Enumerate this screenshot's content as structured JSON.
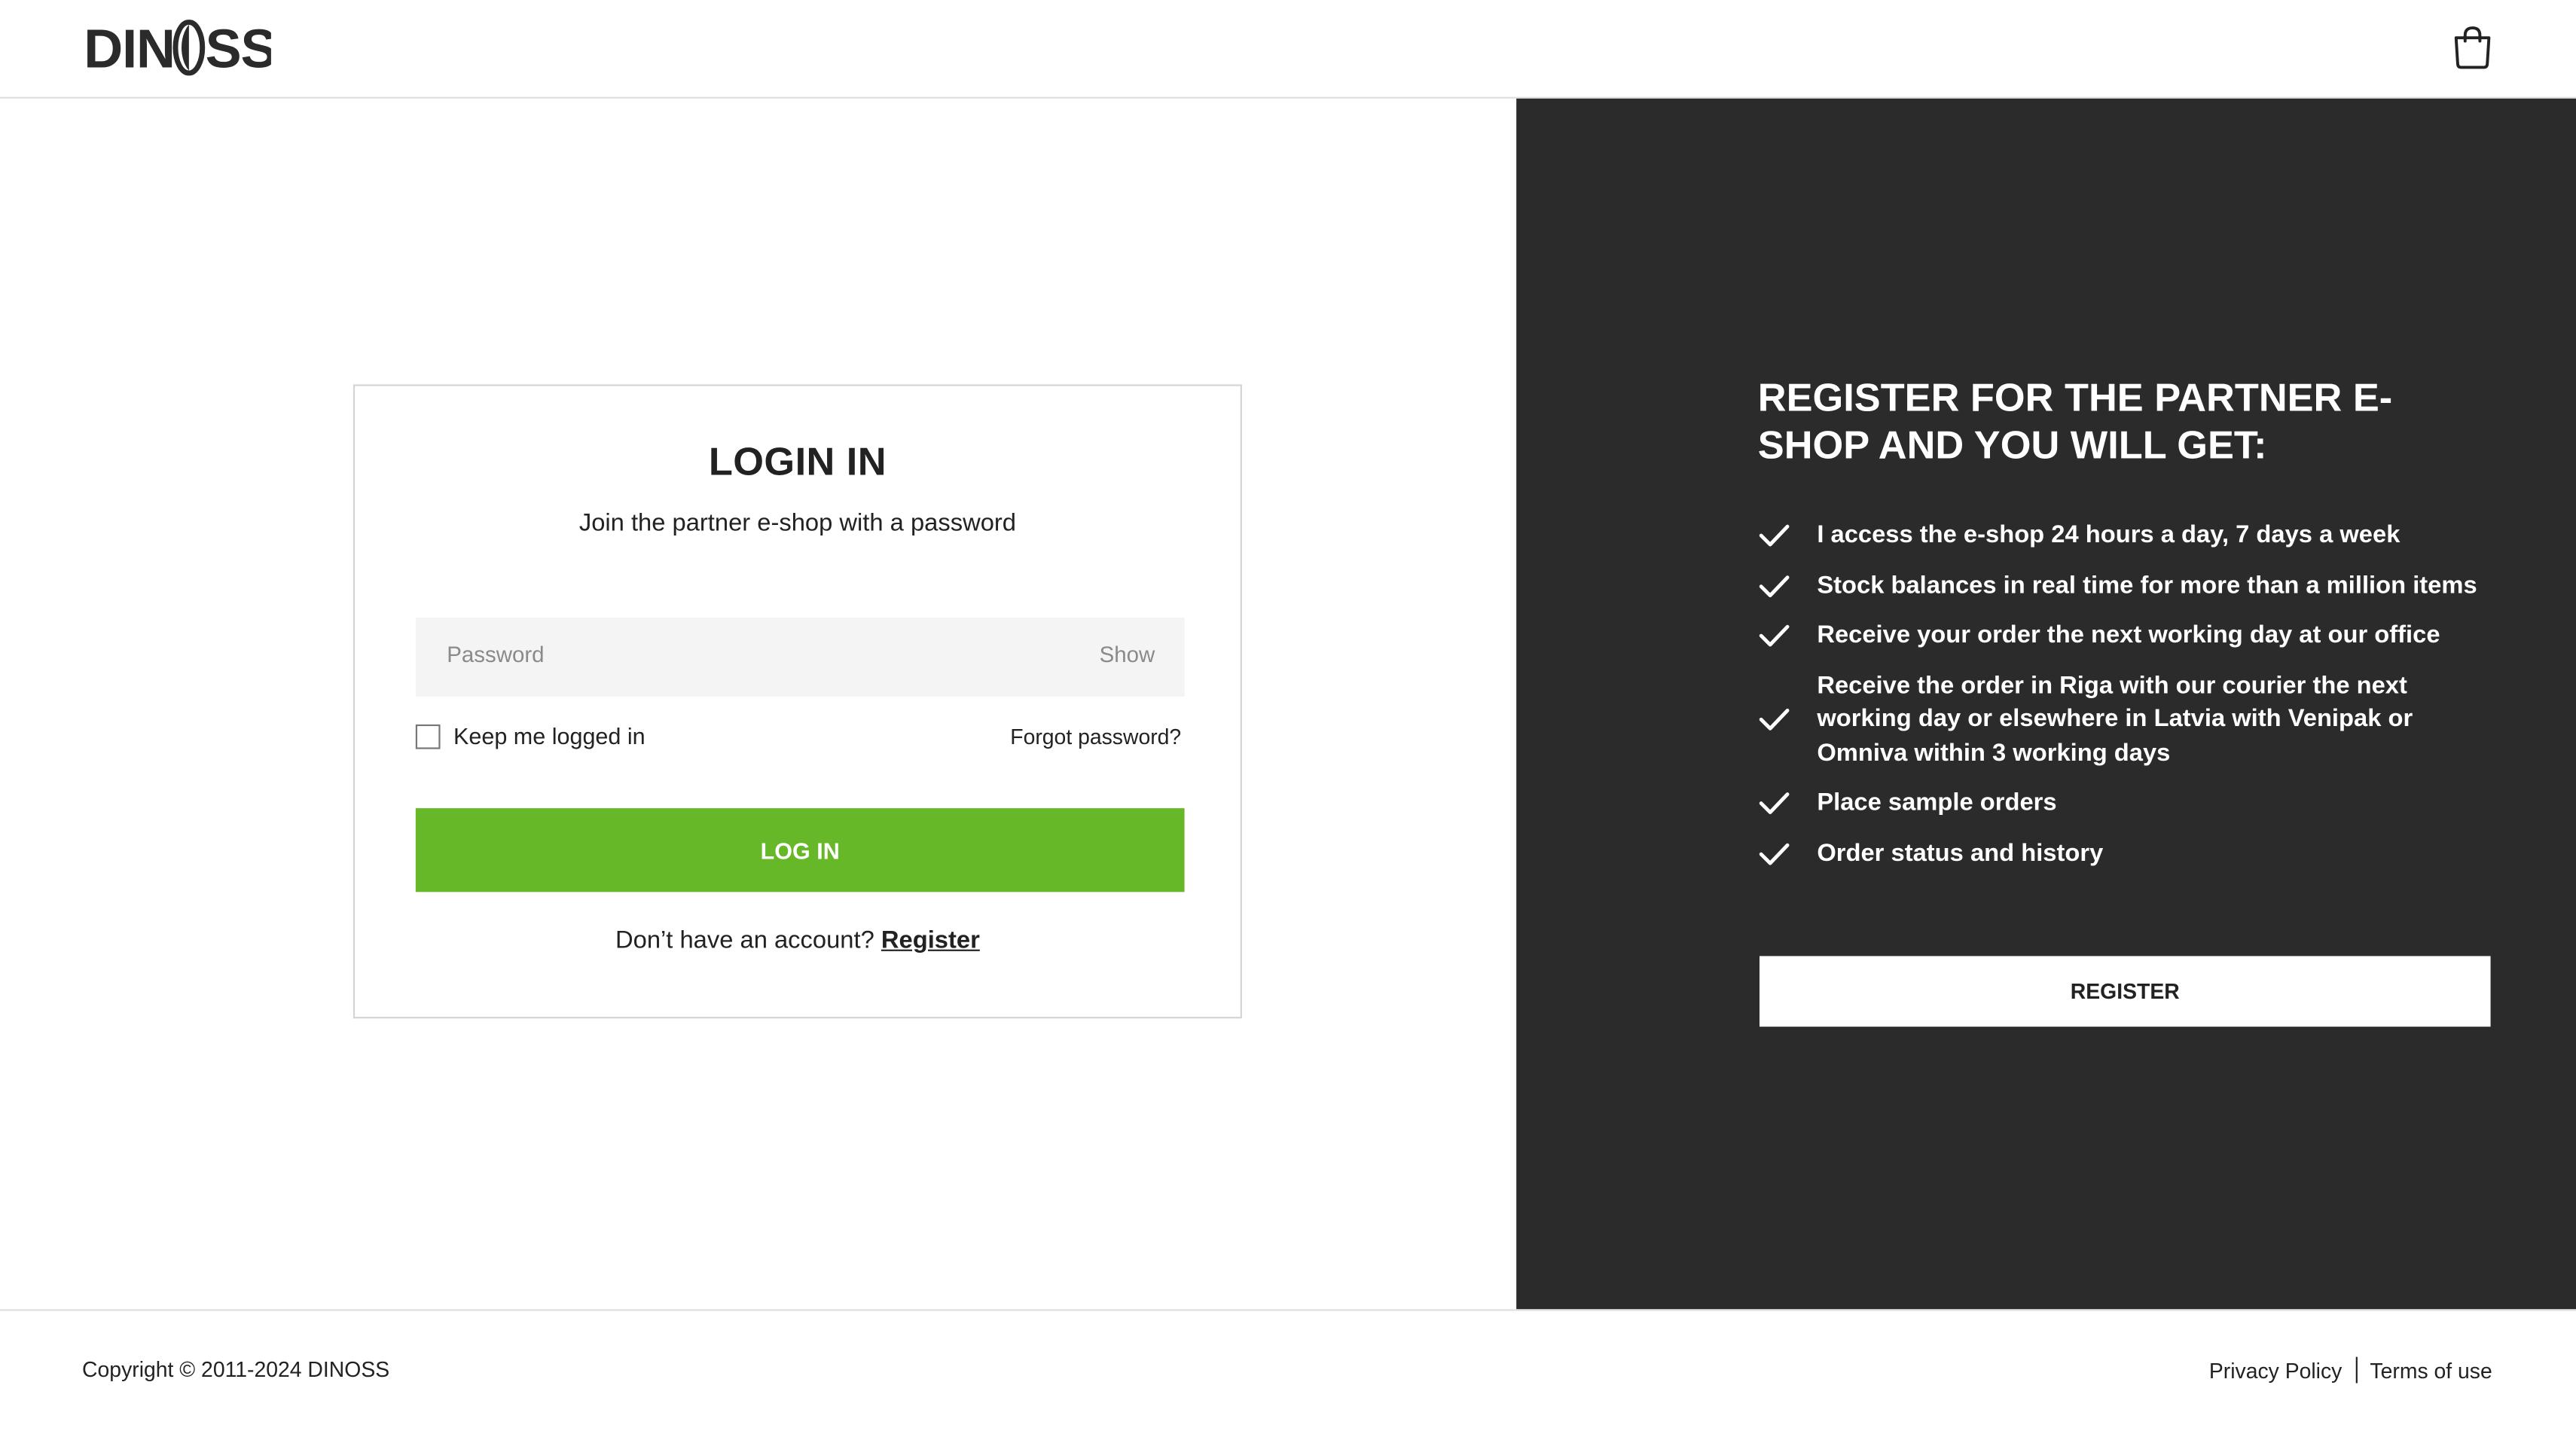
{
  "header": {
    "logo_text": "DINOSS",
    "cart_icon": "shopping-bag-icon"
  },
  "login": {
    "title": "LOGIN IN",
    "subtitle": "Join the partner e-shop with a password",
    "password_placeholder": "Password",
    "show_label": "Show",
    "keep_logged_in_label": "Keep me logged in",
    "keep_logged_in_checked": false,
    "forgot_password_label": "Forgot password?",
    "login_button_label": "LOG IN",
    "no_account_text": "Don’t have an account?",
    "register_link_label": "Register"
  },
  "promo": {
    "title": "REGISTER FOR THE PARTNER E-SHOP AND YOU WILL GET:",
    "benefits": [
      "I access the e-shop 24 hours a day, 7 days a week",
      "Stock balances in real time for more than a million items",
      "Receive your order the next working day at our office",
      "Receive the order in Riga with our courier the next working day or elsewhere in Latvia with Venipak or Omniva within 3 working days",
      "Place sample orders",
      "Order status and history"
    ],
    "register_button_label": "REGISTER"
  },
  "footer": {
    "copyright": "Copyright © 2011-2024 DINOSS",
    "privacy_label": "Privacy Policy",
    "terms_label": "Terms of use"
  },
  "colors": {
    "accent_green": "#67b828",
    "dark_panel": "#2b2b2b",
    "input_bg": "#f4f4f4"
  }
}
